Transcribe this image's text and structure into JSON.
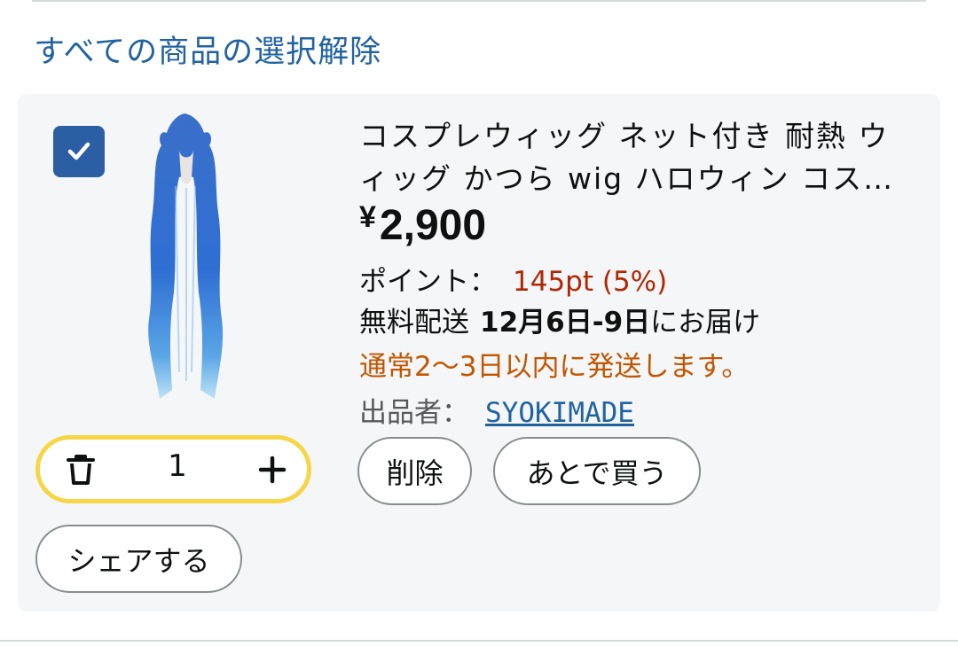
{
  "header": {
    "deselect_all_label": "すべての商品の選択解除"
  },
  "item": {
    "selected": true,
    "image_icon": "blue-long-wig-image",
    "title": "コスプレウィッグ ネット付き 耐熱 ウィッグ かつら wig ハロウィン コス…",
    "price_symbol": "¥",
    "price_value": "2,900",
    "points_label": "ポイント：",
    "points_value": "145pt (5%)",
    "delivery_prefix": "無料配送",
    "delivery_dates": "12月6日-9日",
    "delivery_suffix": "にお届け",
    "shipping_note": "通常2～3日以内に発送します。",
    "seller_label": "出品者：",
    "seller_name": "SYOKIMADE"
  },
  "quantity": {
    "value": "1",
    "decrease_icon": "trash-icon",
    "increase_icon": "plus-icon"
  },
  "actions": {
    "delete_label": "削除",
    "save_for_later_label": "あとで買う",
    "share_label": "シェアする"
  },
  "colors": {
    "link": "#2162a1",
    "checkbox": "#2b5ea3",
    "stepper_border": "#f6d546",
    "points": "#b12704",
    "shipping_note": "#c45500"
  }
}
